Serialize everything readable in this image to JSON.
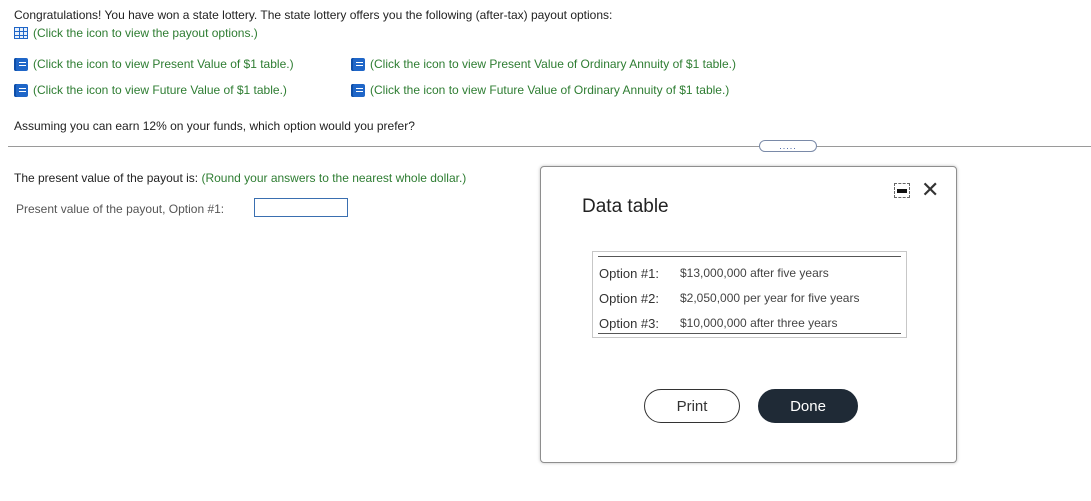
{
  "question": {
    "intro": "Congratulations! You have won a state lottery. The state lottery offers you the following (after-tax) payout options:",
    "payout_link": "(Click the icon to view the payout options.)",
    "table_links": [
      "(Click the icon to view Present Value of $1 table.)",
      "(Click the icon to view Present Value of Ordinary Annuity of $1 table.)",
      "(Click the icon to view Future Value of $1 table.)",
      "(Click the icon to view Future Value of Ordinary Annuity of $1 table.)"
    ],
    "prompt": "Assuming you can earn 12% on your funds, which option would you prefer?",
    "expand_label": "....."
  },
  "answer": {
    "instruction_lead": "The present value of the payout is:",
    "instruction_note": "(Round your answers to the nearest whole dollar.)",
    "field_label": "Present value of the payout, Option #1:",
    "field_value": ""
  },
  "modal": {
    "title": "Data table",
    "rows": [
      {
        "label": "Option #1:",
        "value": "$13,000,000 after five years"
      },
      {
        "label": "Option #2:",
        "value": "$2,050,000 per year for five years"
      },
      {
        "label": "Option #3:",
        "value": "$10,000,000 after three years"
      }
    ],
    "print_label": "Print",
    "done_label": "Done",
    "close_glyph": "✕"
  }
}
